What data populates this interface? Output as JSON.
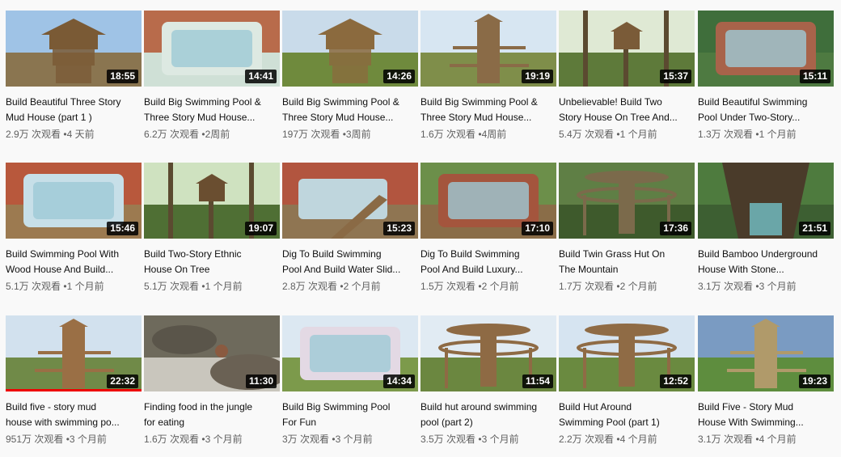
{
  "videos": [
    {
      "title_l1": "Build Beautiful Three Story",
      "title_l2": "Mud House (part 1 )",
      "duration": "18:55",
      "views": "2.9万 次观看",
      "sep": "•",
      "age": "4 天前",
      "sky": "#9fc3e6",
      "ground": "#8a7550",
      "obj": "#7a5a35",
      "obj_icon": "house-icon"
    },
    {
      "title_l1": "Build Big Swimming Pool &",
      "title_l2": "Three Story Mud House...",
      "duration": "14:41",
      "views": "6.2万 次观看",
      "sep": "•",
      "age": "2周前",
      "sky": "#b86b4b",
      "ground": "#cfe0d6",
      "obj": "#dde9e2",
      "obj_icon": "pool-icon"
    },
    {
      "title_l1": "Build Big Swimming Pool &",
      "title_l2": "Three Story Mud House...",
      "duration": "14:26",
      "views": "197万 次观看",
      "sep": "•",
      "age": "3周前",
      "sky": "#c9dbea",
      "ground": "#6f8a3d",
      "obj": "#8b6a3e",
      "obj_icon": "house-icon"
    },
    {
      "title_l1": "Build Big Swimming Pool &",
      "title_l2": "Three Story Mud House...",
      "duration": "19:19",
      "views": "1.6万 次观看",
      "sep": "•",
      "age": "4周前",
      "sky": "#d7e6f2",
      "ground": "#7f8e4a",
      "obj": "#8a6b47",
      "obj_icon": "tower-icon"
    },
    {
      "title_l1": "Unbelievable! Build Two",
      "title_l2": "Story House On Tree And...",
      "duration": "15:37",
      "views": "5.4万 次观看",
      "sep": "•",
      "age": "1 个月前",
      "sky": "#dfe9d4",
      "ground": "#5e7a3a",
      "obj": "#7a5b38",
      "obj_icon": "treehouse-icon"
    },
    {
      "title_l1": "Build Beautiful Swimming",
      "title_l2": "Pool Under Two-Story...",
      "duration": "15:11",
      "views": "1.3万 次观看",
      "sep": "•",
      "age": "1 个月前",
      "sky": "#3f6e3b",
      "ground": "#4e7a41",
      "obj": "#a8634a",
      "obj_icon": "pool-icon"
    },
    {
      "title_l1": "Build Swimming Pool With",
      "title_l2": "Wood House And Build...",
      "duration": "15:46",
      "views": "5.1万 次观看",
      "sep": "•",
      "age": "1 个月前",
      "sky": "#b8583c",
      "ground": "#9c7a50",
      "obj": "#c7dfe8",
      "obj_icon": "pool-icon"
    },
    {
      "title_l1": "Build Two-Story Ethnic",
      "title_l2": "House On Tree",
      "duration": "19:07",
      "views": "5.1万 次观看",
      "sep": "•",
      "age": "1 个月前",
      "sky": "#cfe2c0",
      "ground": "#4f6f34",
      "obj": "#6a4e30",
      "obj_icon": "treehouse-icon"
    },
    {
      "title_l1": "Dig To Build Swimming",
      "title_l2": "Pool And Build Water Slid...",
      "duration": "15:23",
      "views": "2.8万 次观看",
      "sep": "•",
      "age": "2 个月前",
      "sky": "#b2553f",
      "ground": "#8f7552",
      "obj": "#bfd6dd",
      "obj_icon": "slide-icon"
    },
    {
      "title_l1": "Dig To Build Swimming",
      "title_l2": "Pool And Build Luxury...",
      "duration": "17:10",
      "views": "1.5万 次观看",
      "sep": "•",
      "age": "2 个月前",
      "sky": "#6c8f4a",
      "ground": "#8a6d48",
      "obj": "#a4553d",
      "obj_icon": "pool-icon"
    },
    {
      "title_l1": "Build Twin Grass Hut On",
      "title_l2": "The Mountain",
      "duration": "17:36",
      "views": "1.7万 次观看",
      "sep": "•",
      "age": "2 个月前",
      "sky": "#5f7f45",
      "ground": "#3e5a2c",
      "obj": "#7b6a4b",
      "obj_icon": "hut-icon"
    },
    {
      "title_l1": "Build Bamboo Underground",
      "title_l2": "House With Stone...",
      "duration": "21:51",
      "views": "3.1万 次观看",
      "sep": "•",
      "age": "3 个月前",
      "sky": "#4e7b3e",
      "ground": "#3d5f32",
      "obj": "#6aa6a8",
      "obj_icon": "underground-icon"
    },
    {
      "title_l1": "Build five - story mud",
      "title_l2": "house with swimming po...",
      "duration": "22:32",
      "views": "951万 次观看",
      "sep": "•",
      "age": "3 个月前",
      "sky": "#d2e1ee",
      "ground": "#708a48",
      "obj": "#9a6f45",
      "obj_icon": "tower-icon",
      "progress": 1.0
    },
    {
      "title_l1": "Finding food in the jungle",
      "title_l2": "for eating",
      "duration": "11:30",
      "views": "1.6万 次观看",
      "sep": "•",
      "age": "3 个月前",
      "sky": "#6e6a5c",
      "ground": "#c9c6bd",
      "obj": "#8a5a40",
      "obj_icon": "river-icon"
    },
    {
      "title_l1": "Build Big Swimming Pool",
      "title_l2": "For Fun",
      "duration": "14:34",
      "views": "3万 次观看",
      "sep": "•",
      "age": "3 个月前",
      "sky": "#dce8f2",
      "ground": "#7c9a4b",
      "obj": "#e3d9e4",
      "obj_icon": "pool-icon"
    },
    {
      "title_l1": "Build hut around swimming",
      "title_l2": "pool (part 2)",
      "duration": "11:54",
      "views": "3.5万 次观看",
      "sep": "•",
      "age": "3 个月前",
      "sky": "#e1ebf3",
      "ground": "#6b8740",
      "obj": "#8e6a44",
      "obj_icon": "hut-icon"
    },
    {
      "title_l1": "Build Hut Around",
      "title_l2": "Swimming Pool (part 1)",
      "duration": "12:52",
      "views": "2.2万 次观看",
      "sep": "•",
      "age": "4 个月前",
      "sky": "#d6e4f1",
      "ground": "#6a8a40",
      "obj": "#8f6b45",
      "obj_icon": "hut-icon"
    },
    {
      "title_l1": "Build Five - Story Mud",
      "title_l2": "House With Swimming...",
      "duration": "19:23",
      "views": "3.1万 次观看",
      "sep": "•",
      "age": "4 个月前",
      "sky": "#7a9bc2",
      "ground": "#5e8d3e",
      "obj": "#b09a6a",
      "obj_icon": "tower-icon"
    }
  ]
}
